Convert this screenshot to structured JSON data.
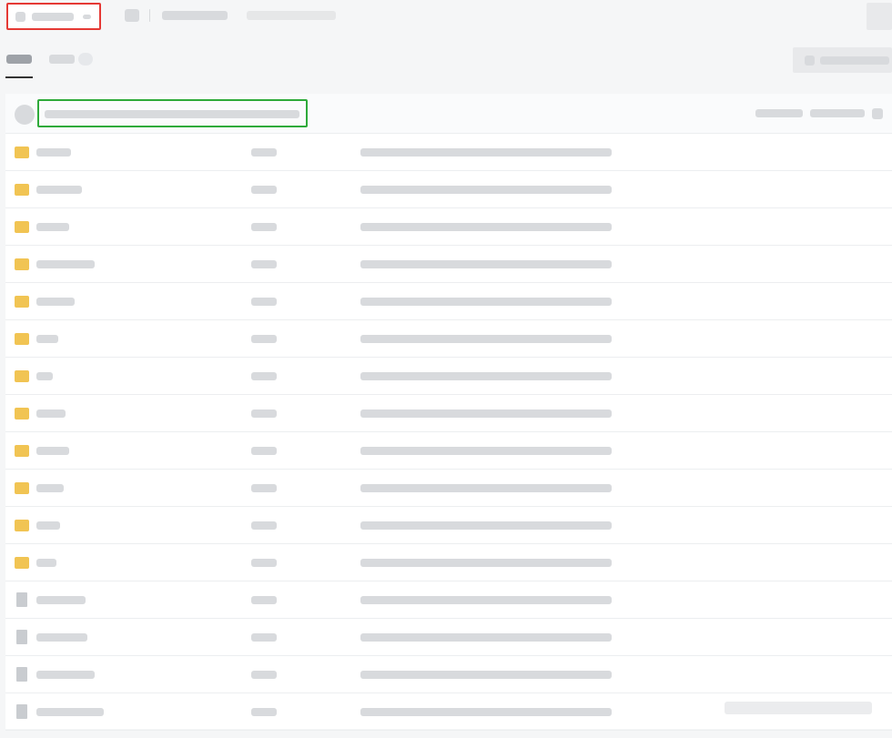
{
  "app": "git-repo-file-browser",
  "text_rendering": "none",
  "colors": {
    "page_bg": "#f5f6f7",
    "panel_bg": "#ffffff",
    "text_placeholder": "#d8dadd",
    "branch_highlight": "#e53935",
    "commit_highlight": "#2eaa3a",
    "active_tab_underline": "#333333"
  },
  "file_rows": 16
}
